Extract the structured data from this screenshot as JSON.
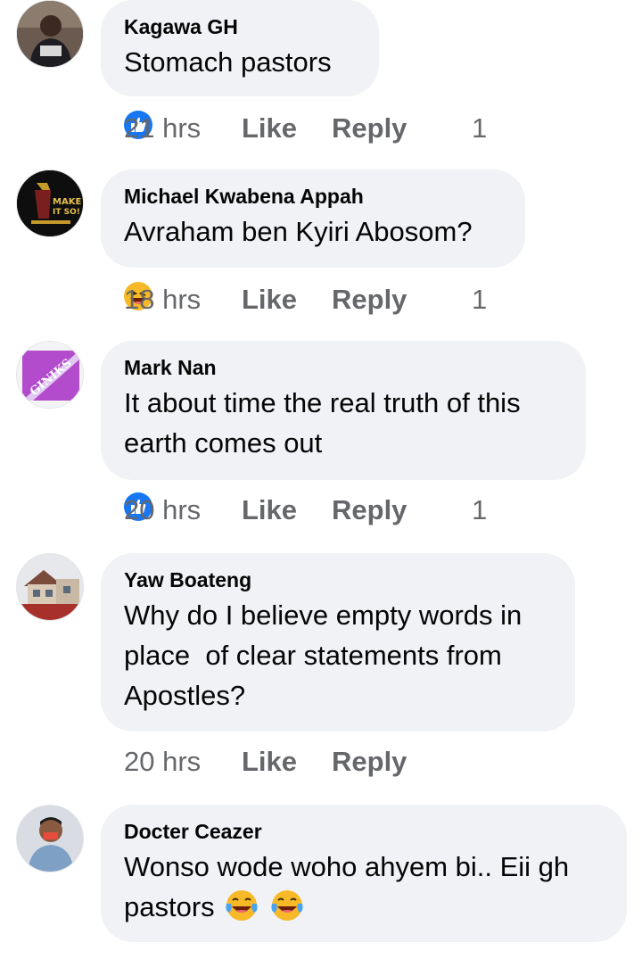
{
  "comments": [
    {
      "author": "Kagawa GH",
      "text": "Stomach pastors",
      "time": "21 hrs",
      "like_label": "Like",
      "reply_label": "Reply",
      "reaction": "like-reaction-icon",
      "reaction_count": "1"
    },
    {
      "author": "Michael Kwabena Appah",
      "text": "Avraham ben Kyiri Abosom?",
      "time": "18 hrs",
      "like_label": "Like",
      "reply_label": "Reply",
      "reaction": "haha-reaction-icon",
      "reaction_count": "1",
      "avatar_text_1": "MAKE",
      "avatar_text_2": "IT SO!"
    },
    {
      "author": "Mark Nan",
      "text_line1": "It about time the real truth of this",
      "text_line2": "earth comes out",
      "time": "20 hrs",
      "like_label": "Like",
      "reply_label": "Reply",
      "reaction": "like-reaction-icon",
      "reaction_count": "1",
      "avatar_text": "GINIKS"
    },
    {
      "author": "Yaw Boateng",
      "text_line1": "Why do I believe empty words in",
      "text_line2": "place  of clear statements from",
      "text_line3": "Apostles?",
      "time": "20 hrs",
      "like_label": "Like",
      "reply_label": "Reply"
    },
    {
      "author": "Docter Ceazer",
      "text_line1": "Wonso wode woho ahyem bi.. Eii gh",
      "text_line2": "pastors",
      "emoji": [
        "tears-of-joy-emoji",
        "tears-of-joy-emoji"
      ]
    }
  ],
  "colors": {
    "bubble": "#f0f2f5",
    "meta_text": "#65676b",
    "name_text": "#050505",
    "like_blue": "#1877f2",
    "haha_yellow": "#f7b928"
  }
}
